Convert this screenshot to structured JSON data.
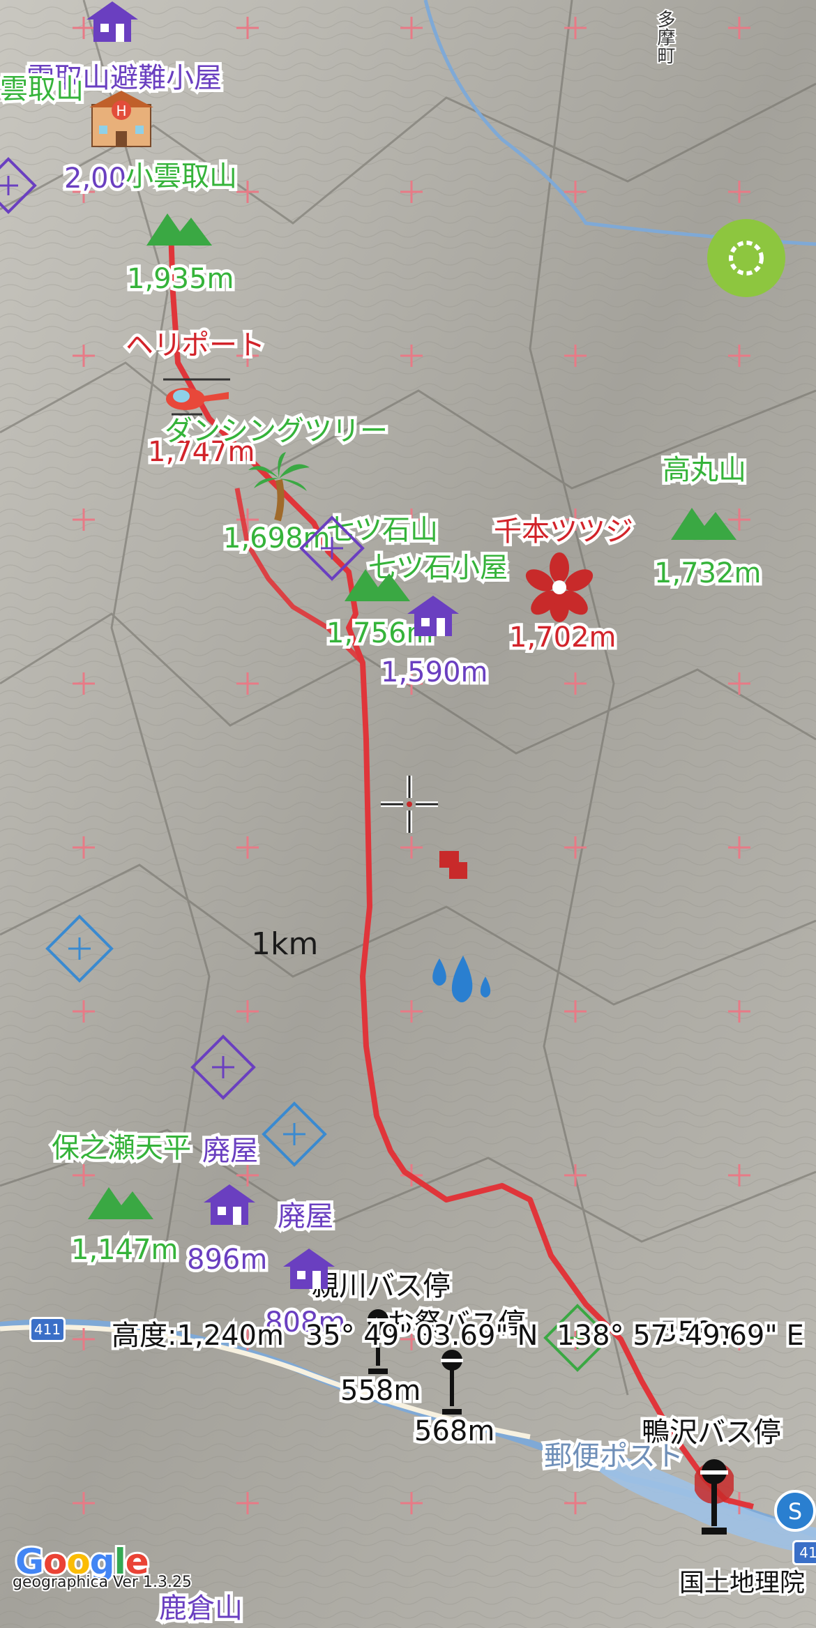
{
  "map": {
    "scale_label": "1km",
    "town_label": "多摩町",
    "route_color": "#e0353a",
    "terrain_color": "#a9a8a2"
  },
  "waypoints": {
    "kumotori_hut": "雲取山避難小屋",
    "kumotori_hut_elev": "2,00",
    "kumotori_peak_cut": "雲取山",
    "kokumotori": "小雲取山",
    "kokumotori_elev": "1,935m",
    "heliport": "ヘリポート",
    "heliport_elev": "1,747m",
    "dancing_tree": "ダンシングツリー",
    "dancing_tree_elev": "1,698m",
    "nanatsuishi": "七ツ石山",
    "nanatsuishi_elev": "1,756m",
    "nanatsuishi_hut": "七ツ石小屋",
    "nanatsuishi_hut_elev": "1,590m",
    "senbon": "千本ツツジ",
    "senbon_elev": "1,702m",
    "takamaru": "高丸山",
    "takamaru_elev": "1,732m",
    "honose": "保之瀬天平",
    "honose_elev": "1,147m",
    "ruin1": "廃屋",
    "ruin1_elev": "896m",
    "ruin2": "廃屋",
    "ruin2_elev": "808m",
    "oyakawa": "親川バス停",
    "omatsuri": "お祭バス停",
    "omatsuri_elev1": "558m",
    "omatsuri_elev2": "568m",
    "kamosawa": "鴨沢バス停",
    "post": "郵便ポスト",
    "kamosawa_elev": "558m",
    "kakurayama": "鹿倉山"
  },
  "roads": {
    "r411_left": "411",
    "r411_right": "41"
  },
  "status": {
    "elevation": "高度:1,240m",
    "lat": "35° 49' 03.69\" N",
    "lon": "138° 57' 49.69\" E"
  },
  "branding": {
    "google_letters": [
      "G",
      "o",
      "o",
      "g",
      "l",
      "e"
    ],
    "version": "geographica Ver 1.3.25",
    "credit": "国土地理院"
  },
  "icons": [
    "hut-icon",
    "hotel-icon",
    "mountain-icon",
    "helicopter-icon",
    "palm-tree-icon",
    "flower-icon",
    "water-drop-icon",
    "bus-stop-icon",
    "crosshair-icon",
    "compass-icon",
    "diamond-marker-icon",
    "route-marker-icon",
    "parking-icon"
  ]
}
